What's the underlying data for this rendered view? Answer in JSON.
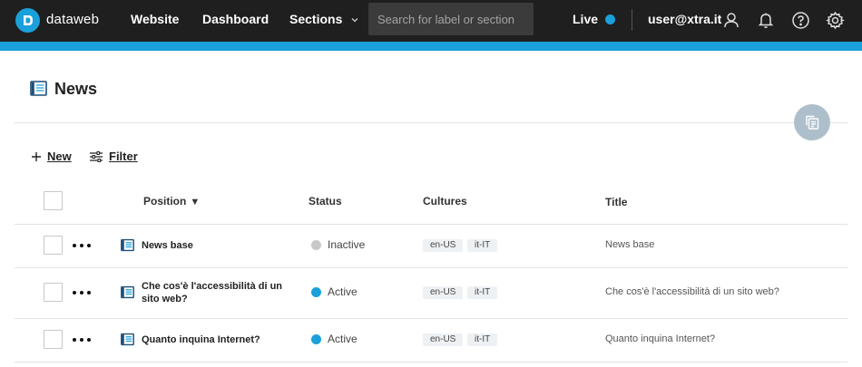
{
  "brand": {
    "name": "dataweb"
  },
  "nav": {
    "website": "Website",
    "dashboard": "Dashboard",
    "sections": "Sections"
  },
  "search": {
    "placeholder": "Search for label or section"
  },
  "live": {
    "label": "Live"
  },
  "user": {
    "email": "user@xtra.it"
  },
  "page": {
    "title": "News"
  },
  "toolbar": {
    "new_label": "New",
    "filter_label": "Filter"
  },
  "table": {
    "columns": {
      "position": "Position",
      "status": "Status",
      "cultures": "Cultures",
      "title": "Title"
    },
    "sort_indicator": "▼",
    "rows": [
      {
        "name_lines": [
          "News base"
        ],
        "status": "Inactive",
        "cultures": [
          "en-US",
          "it-IT"
        ],
        "title": "News base"
      },
      {
        "name_lines": [
          "Che cos'è l'accessibilità di un",
          "sito web?"
        ],
        "status": "Active",
        "cultures": [
          "en-US",
          "it-IT"
        ],
        "title": "Che cos'è l'accessibilità di un sito web?"
      },
      {
        "name_lines": [
          "Quanto inquina Internet?"
        ],
        "status": "Active",
        "cultures": [
          "en-US",
          "it-IT"
        ],
        "title": "Quanto inquina Internet?"
      }
    ]
  },
  "colors": {
    "topbar_bg": "#1f1f1f",
    "accent": "#1aa0db",
    "status_active": "#1aa0db",
    "status_inactive": "#c8c8c8",
    "fab_bg": "#aebfcc"
  },
  "icons": {
    "brand": "dataweb-logo-icon",
    "user": "user-icon",
    "notifications": "bell-icon",
    "help": "help-icon",
    "settings": "gear-icon",
    "page": "newspaper-icon",
    "new": "plus-icon",
    "filter": "filter-icon",
    "copy": "copy-icon",
    "more": "more-dots-icon"
  }
}
